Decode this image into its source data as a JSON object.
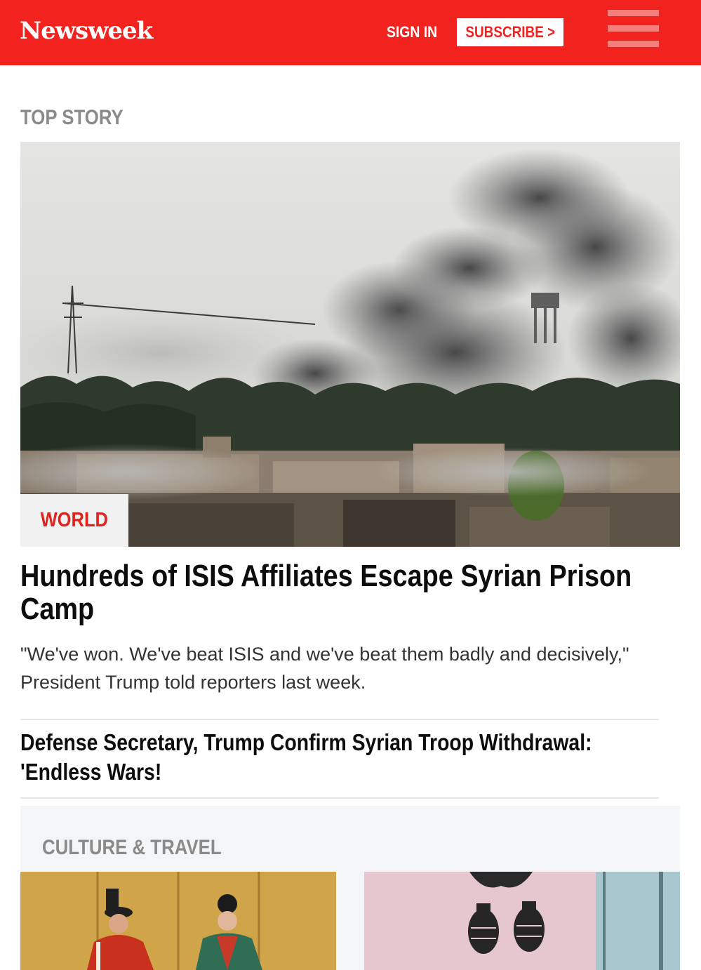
{
  "header": {
    "logo": "Newsweek",
    "sign_in": "SIGN IN",
    "subscribe": "SUBSCRIBE >",
    "background": "#f2231f"
  },
  "top_story": {
    "section_label": "TOP STORY",
    "image_icon": "photo-smoke-over-town",
    "category": "WORLD",
    "headline": "Hundreds of ISIS Affiliates Escape Syrian Prison Camp",
    "summary": "\"We've won. We've beat ISIS and we've beat them badly and decisively,\" President Trump told reporters last week."
  },
  "related": {
    "headline": "Defense Secretary, Trump Confirm Syrian Troop Withdrawal: 'Endless Wars!"
  },
  "culture": {
    "section_label": "CULTURE & TRAVEL",
    "thumbs": [
      {
        "image_icon": "photo-ceremonial-couple"
      },
      {
        "image_icon": "photo-grenade-graffiti"
      }
    ]
  }
}
